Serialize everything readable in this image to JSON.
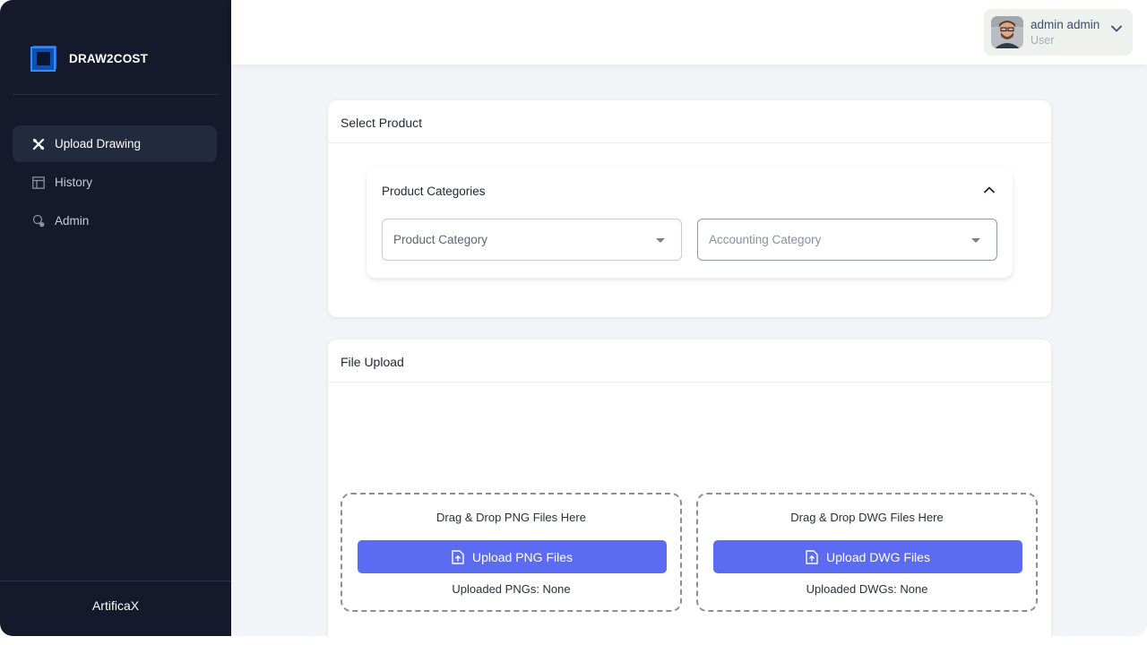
{
  "app": {
    "brand": "DRAW2COST",
    "footer": "ArtificaX"
  },
  "sidebar": {
    "items": [
      {
        "label": "Upload Drawing",
        "icon": "tools-icon",
        "active": true
      },
      {
        "label": "History",
        "icon": "table-icon",
        "active": false
      },
      {
        "label": "Admin",
        "icon": "admin-shield-icon",
        "active": false
      }
    ]
  },
  "user": {
    "name": "admin admin",
    "role": "User"
  },
  "select_product": {
    "title": "Select Product",
    "accordion_title": "Product Categories",
    "product_category_placeholder": "Product Category",
    "accounting_category_placeholder": "Accounting Category"
  },
  "file_upload": {
    "title": "File Upload",
    "png": {
      "drop_text": "Drag & Drop PNG Files Here",
      "button": "Upload PNG Files",
      "status": "Uploaded PNGs: None"
    },
    "dwg": {
      "drop_text": "Drag & Drop DWG Files Here",
      "button": "Upload DWG Files",
      "status": "Uploaded DWGs: None"
    }
  },
  "colors": {
    "sidebar": "#141a2c",
    "accent": "#5b6cf3",
    "background": "#f3f4f7"
  }
}
